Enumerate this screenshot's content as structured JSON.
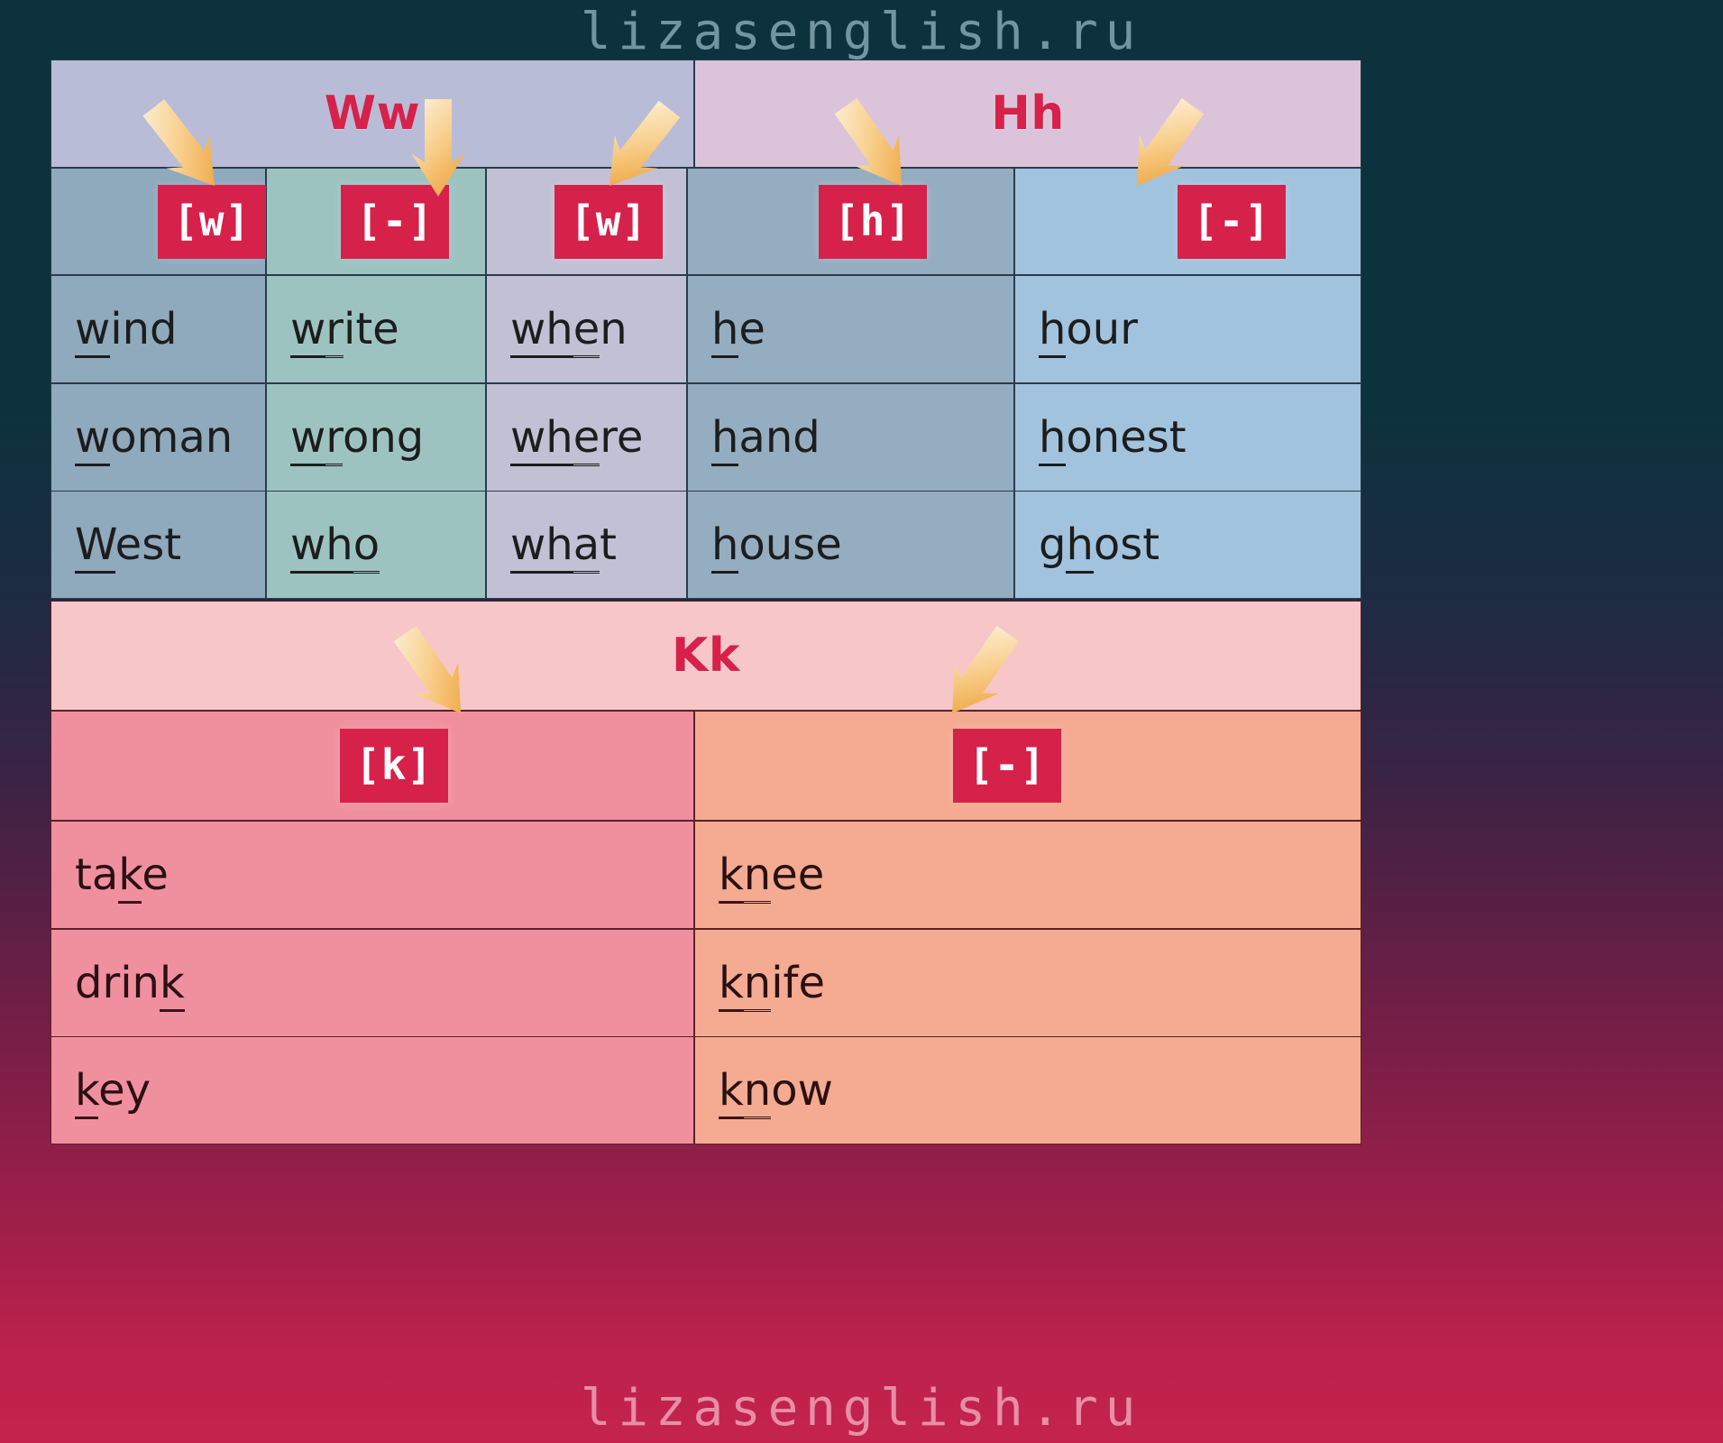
{
  "watermarks": {
    "top": "lizasenglish.ru",
    "middle": "lizasenglish.ru",
    "bottom": "lizasenglish.ru"
  },
  "colors": {
    "badge": "#d6214b",
    "letter": "#d6214b",
    "arrow_light": "#fdf0d8",
    "arrow_dark": "#f4b959",
    "bg_top": "#0c323d",
    "bg_bottom": "#c5234d"
  },
  "sections": [
    {
      "id": "ww",
      "letter": "Ww",
      "banner_color": "#b8bcd6",
      "columns": [
        {
          "sound": "[w]",
          "fill": "#8fa9bd",
          "words": [
            {
              "pre": "",
              "mark1": "w",
              "mark2": "",
              "post": "ind",
              "text": "wind"
            },
            {
              "pre": "",
              "mark1": "w",
              "mark2": "",
              "post": "oman",
              "text": "woman"
            },
            {
              "pre": "",
              "mark1": "W",
              "mark2": "",
              "post": "est",
              "text": "West"
            }
          ]
        },
        {
          "sound": "[-]",
          "fill": "#9dc3c1",
          "words": [
            {
              "pre": "",
              "mark1": "w",
              "mark2": "r",
              "post": "ite",
              "text": "write"
            },
            {
              "pre": "",
              "mark1": "w",
              "mark2": "r",
              "post": "ong",
              "text": "wrong"
            },
            {
              "pre": "",
              "mark1": "wh",
              "mark2": "o",
              "post": "",
              "text": "who"
            }
          ]
        },
        {
          "sound": "[w]",
          "fill": "#c2c0d4",
          "words": [
            {
              "pre": "",
              "mark1": "wh",
              "mark2": "e",
              "post": "n",
              "text": "when"
            },
            {
              "pre": "",
              "mark1": "wh",
              "mark2": "e",
              "post": "re",
              "text": "where"
            },
            {
              "pre": "",
              "mark1": "wh",
              "mark2": "a",
              "post": "t",
              "text": "what"
            }
          ]
        }
      ]
    },
    {
      "id": "hh",
      "letter": "Hh",
      "banner_color": "#dbc4da",
      "columns": [
        {
          "sound": "[h]",
          "fill": "#95adc0",
          "words": [
            {
              "pre": "",
              "mark1": "h",
              "mark2": "",
              "post": "e",
              "text": "he"
            },
            {
              "pre": "",
              "mark1": "h",
              "mark2": "",
              "post": "and",
              "text": "hand"
            },
            {
              "pre": "",
              "mark1": "h",
              "mark2": "",
              "post": "ouse",
              "text": "house"
            }
          ]
        },
        {
          "sound": "[-]",
          "fill": "#a2c3dd",
          "words": [
            {
              "pre": "",
              "mark1": "h",
              "mark2": "",
              "post": "our",
              "text": "hour"
            },
            {
              "pre": "",
              "mark1": "h",
              "mark2": "",
              "post": "onest",
              "text": "honest"
            },
            {
              "pre": "g",
              "mark1": "h",
              "mark2": "",
              "post": "ost",
              "text": "ghost"
            }
          ]
        }
      ]
    },
    {
      "id": "kk",
      "letter": "Kk",
      "banner_color": "#f7c6c9",
      "columns": [
        {
          "sound": "[k]",
          "fill": "#f0909f",
          "words": [
            {
              "pre": "ta",
              "mark1": "k",
              "mark2": "",
              "post": "e",
              "text": "take"
            },
            {
              "pre": "drin",
              "mark1": "k",
              "mark2": "",
              "post": "",
              "text": "drink"
            },
            {
              "pre": "",
              "mark1": "k",
              "mark2": "",
              "post": "ey",
              "text": "key"
            }
          ]
        },
        {
          "sound": "[-]",
          "fill": "#f4ab92",
          "words": [
            {
              "pre": "",
              "mark1": "k",
              "mark2": "n",
              "post": "ee",
              "text": "knee"
            },
            {
              "pre": "",
              "mark1": "k",
              "mark2": "n",
              "post": "ife",
              "text": "knife"
            },
            {
              "pre": "",
              "mark1": "k",
              "mark2": "n",
              "post": "ow",
              "text": "know"
            }
          ]
        }
      ]
    }
  ]
}
